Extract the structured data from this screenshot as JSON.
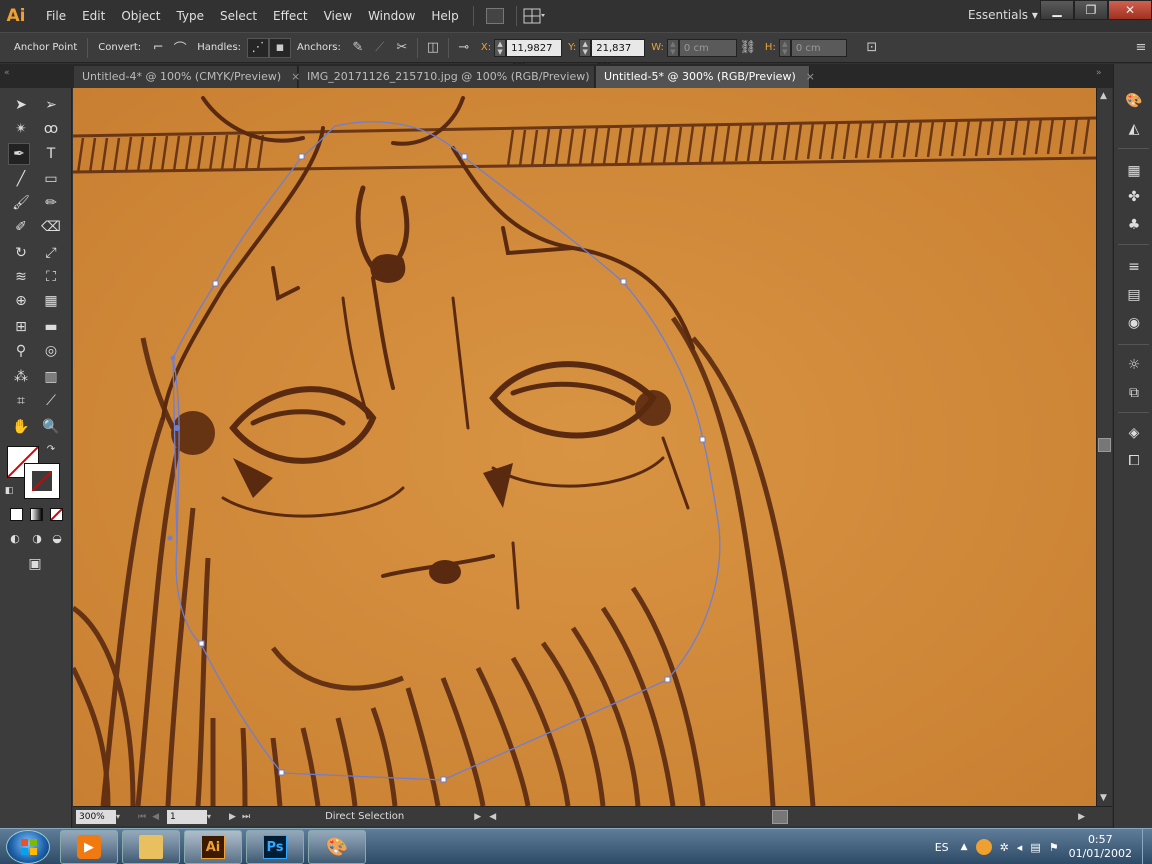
{
  "app": {
    "logo": "Ai"
  },
  "menu": {
    "items": [
      "File",
      "Edit",
      "Object",
      "Type",
      "Select",
      "Effect",
      "View",
      "Window",
      "Help"
    ]
  },
  "workspace": "Essentials",
  "window_buttons": {
    "minimize": "▁",
    "restore": "❐",
    "close": "✕"
  },
  "control": {
    "tool_name": "Anchor Point",
    "convert_label": "Convert:",
    "handles_label": "Handles:",
    "anchors_label": "Anchors:",
    "x_label": "X:",
    "x_value": "11,9827 cm",
    "y_label": "Y:",
    "y_value": "21,837 cm",
    "w_label": "W:",
    "w_value": "0 cm",
    "h_label": "H:",
    "h_value": "0 cm"
  },
  "tabs": [
    {
      "label": "Untitled-4* @ 100% (CMYK/Preview)",
      "close": "×"
    },
    {
      "label": "IMG_20171126_215710.jpg @ 100% (RGB/Preview)",
      "close": "×"
    },
    {
      "label": "Untitled-5* @ 300% (RGB/Preview)",
      "close": "×"
    }
  ],
  "status": {
    "zoom": "300%",
    "artboard": "1",
    "current_tool": "Direct Selection"
  },
  "taskbar": {
    "apps": [
      "Media",
      "Explorer",
      "Ai",
      "Ps",
      "Paint"
    ],
    "lang": "ES",
    "time": "0:57",
    "date": "01/01/2002"
  },
  "colors": {
    "canvas_bg": "#d28c3a",
    "ink": "#5a2a10",
    "path": "#6f7fd0",
    "accent": "#f0a030"
  },
  "icons": {
    "selection": "selection-arrow-icon",
    "direct_selection": "direct-selection-icon",
    "pen": "pen-icon",
    "type": "type-icon",
    "zoom": "zoom-icon",
    "hand": "hand-icon"
  }
}
